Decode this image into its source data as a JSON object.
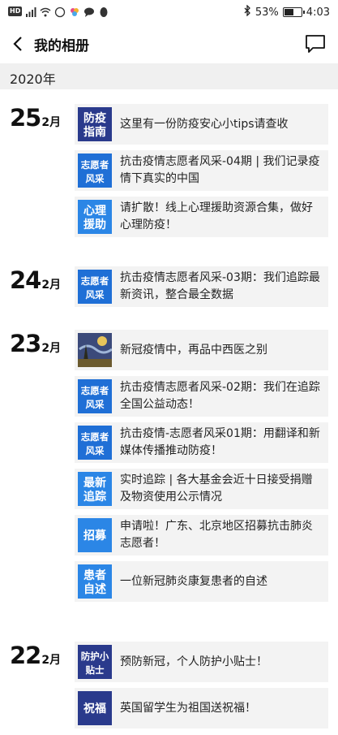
{
  "status_bar": {
    "hd": "HD",
    "battery_text": "53%",
    "battery_level": 0.53,
    "time": "4:03"
  },
  "nav": {
    "title": "我的相册",
    "back_icon": "chevron-left-icon",
    "message_icon": "message-icon"
  },
  "year": "2020年",
  "days": [
    {
      "day": "25",
      "month": "2月",
      "posts": [
        {
          "title": "这里有一份防疫安心小tips请查收",
          "thumb_text": "防疫指南",
          "thumb_bg": "#2a3a8c"
        },
        {
          "title": "抗击疫情志愿者风采-04期 | 我们记录疫情下真实的中国",
          "thumb_text": "志愿者风采",
          "thumb_bg": "#1f6fd6"
        },
        {
          "title": "请扩散！线上心理援助资源合集，做好心理防疫！",
          "thumb_text": "心理援助",
          "thumb_bg": "#2b86e6"
        }
      ]
    },
    {
      "day": "24",
      "month": "2月",
      "posts": [
        {
          "title": "抗击疫情志愿者风采-03期：我们追踪最新资讯，整合最全数据",
          "thumb_text": "志愿者风采",
          "thumb_bg": "#1f6fd6"
        }
      ]
    },
    {
      "day": "23",
      "month": "2月",
      "posts": [
        {
          "title": "新冠疫情中，再品中西医之别",
          "thumb_text": "",
          "thumb_bg": "#3b4a7a"
        },
        {
          "title": "抗击疫情志愿者风采-02期：我们在追踪全国公益动态！",
          "thumb_text": "志愿者风采",
          "thumb_bg": "#1f6fd6"
        },
        {
          "title": "抗击疫情-志愿者风采01期：用翻译和新媒体传播推动防疫！",
          "thumb_text": "志愿者风采",
          "thumb_bg": "#1f6fd6"
        },
        {
          "title": "实时追踪 | 各大基金会近十日接受捐赠及物资使用公示情况",
          "thumb_text": "最新追踪",
          "thumb_bg": "#2b86e6"
        },
        {
          "title": "申请啦！广东、北京地区招募抗击肺炎志愿者！",
          "thumb_text": "招募",
          "thumb_bg": "#2b86e6"
        },
        {
          "title": "一位新冠肺炎康复患者的自述",
          "thumb_text": "患者自述",
          "thumb_bg": "#2b86e6"
        }
      ]
    },
    {
      "day": "22",
      "month": "2月",
      "posts": [
        {
          "title": "预防新冠，个人防护小贴士！",
          "thumb_text": "防护小贴士",
          "thumb_bg": "#2a3a8c"
        },
        {
          "title": "英国留学生为祖国送祝福！",
          "thumb_text": "祝福",
          "thumb_bg": "#2a3a8c"
        }
      ]
    }
  ]
}
